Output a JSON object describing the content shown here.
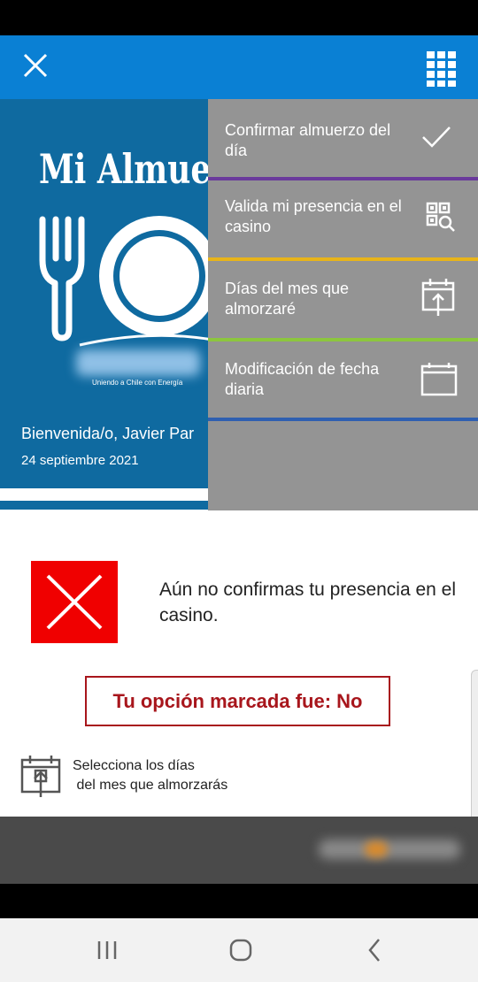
{
  "header": {
    "close_icon": "close-icon",
    "grid_icon": "apps-grid-icon",
    "bar_color": "#0a80d4"
  },
  "banner": {
    "title": "Mi Almuerzo",
    "tagline": "Uniendo a Chile con Energía",
    "welcome": "Bienvenida/o, Javier Par",
    "date": "24 septiembre 2021",
    "color": "#0f6aa0"
  },
  "menu": {
    "items": [
      {
        "label": "Confirmar almuerzo del día",
        "icon": "check-icon",
        "separator_color": "#6a3a9c"
      },
      {
        "label": "Valida mi presencia en el casino",
        "icon": "qr-scan-icon",
        "separator_color": "#e8b41a"
      },
      {
        "label": "Días del mes que almorzaré",
        "icon": "calendar-upload-icon",
        "separator_color": "#8cc63e"
      },
      {
        "label": "Modificación de fecha diaria",
        "icon": "calendar-icon",
        "separator_color": "#2f5fb0"
      }
    ]
  },
  "main": {
    "status_text": "Aún no confirmas tu presencia en el casino.",
    "status_icon": "red-x-icon",
    "option_text": "Tu opción marcada fue: No",
    "days_link": "Selecciona los días\n del mes que almorzarás",
    "days_icon": "calendar-upload-icon"
  },
  "navbar": {
    "recents_icon": "recents-icon",
    "home_icon": "home-icon",
    "back_icon": "back-icon"
  }
}
